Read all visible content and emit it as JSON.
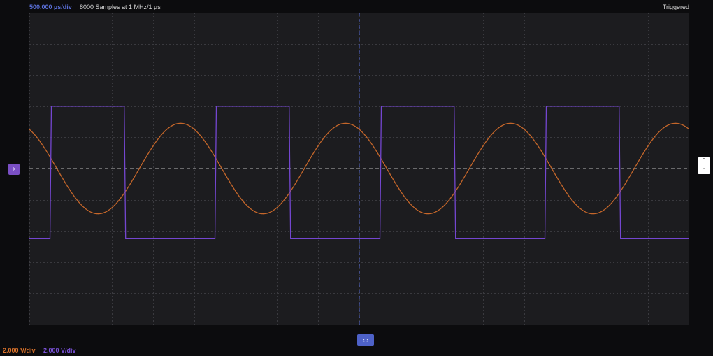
{
  "header": {
    "timebase": "500.000 µs/div",
    "samples": "8000 Samples at 1 MHz/1 µs",
    "trigger_status": "Triggered"
  },
  "footer": {
    "ch1_scale": "2.000 V/div",
    "ch2_scale": "2.000 V/div"
  },
  "markers": {
    "channel_offset_icon": "chevron-right-icon",
    "trigger_level_icon": "chevron-up-down-icon",
    "trigger_position_icon": "chevron-left-right-icon"
  },
  "colors": {
    "background": "#0c0c0e",
    "plot": "#1c1c1f",
    "grid": "#3a3a3f",
    "sine": "#c4662a",
    "square": "#7446d0",
    "timebase": "#5a6fd8"
  },
  "chart_data": {
    "type": "line",
    "grid": true,
    "divisions": {
      "x": 16,
      "y": 10
    },
    "series": [
      {
        "kind": "sine",
        "color": "#c4662a",
        "scale_v_per_div": 2.0,
        "amplitude_div": 1.45,
        "offset_div": 0,
        "period_div": 4.0,
        "phase_deg": 120
      },
      {
        "kind": "square",
        "color": "#7446d0",
        "scale_v_per_div": 2.0,
        "high_div": 2.0,
        "low_div": -2.25,
        "period_div": 4.0,
        "duty": 0.45,
        "rise_start_div": 0.5
      }
    ]
  }
}
